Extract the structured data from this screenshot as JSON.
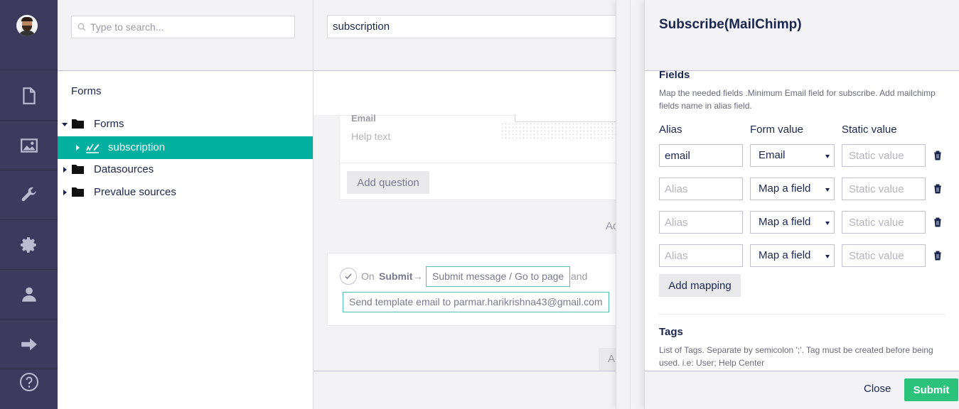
{
  "search": {
    "placeholder": "Type to search..."
  },
  "tree": {
    "title": "Forms",
    "nodes": [
      {
        "label": "Forms"
      },
      {
        "label": "subscription"
      },
      {
        "label": "Datasources"
      },
      {
        "label": "Prevalue sources"
      }
    ]
  },
  "editor": {
    "form_name": "subscription",
    "question_label": "Email",
    "help_text": "Help text",
    "add_question": "Add question",
    "ghost_add": "Ad",
    "ghost_add2": "A",
    "submit_row": {
      "on": "On",
      "submit": "Submit",
      "arrow": "→",
      "message": "Submit message / Go to page",
      "and": "and",
      "workflow": "Send template email to parmar.harikrishna43@gmail.com"
    }
  },
  "panel": {
    "title": "Subscribe(MailChimp)",
    "fields": {
      "heading": "Fields",
      "description": "Map the needed fields .Minimum Email field for subscribe. Add mailchimp fields name in alias field.",
      "col_alias": "Alias",
      "col_form_value": "Form value",
      "col_static_value": "Static value",
      "rows": [
        {
          "alias": "email",
          "alias_placeholder": "Alias",
          "form_value": "Email",
          "static_placeholder": "Static value"
        },
        {
          "alias": "",
          "alias_placeholder": "Alias",
          "form_value": "Map a field",
          "static_placeholder": "Static value"
        },
        {
          "alias": "",
          "alias_placeholder": "Alias",
          "form_value": "Map a field",
          "static_placeholder": "Static value"
        },
        {
          "alias": "",
          "alias_placeholder": "Alias",
          "form_value": "Map a field",
          "static_placeholder": "Static value"
        }
      ],
      "add_mapping": "Add mapping"
    },
    "tags": {
      "heading": "Tags",
      "description": "List of Tags. Separate by semicolon ';'. Tag must be created before being used. i.e: User; Help Center"
    },
    "close": "Close",
    "submit": "Submit"
  },
  "colors": {
    "rail": "#3e3a5e",
    "selected": "#03b0a0",
    "submit": "#2bc37c",
    "text": "#1b264f"
  },
  "icons": [
    "user-avatar",
    "content-icon",
    "media-icon",
    "settings-wrench-icon",
    "gear-icon",
    "member-icon",
    "forms-arrow-icon",
    "help-icon",
    "search-icon",
    "folder-icon",
    "form-icon",
    "check-icon",
    "trash-icon"
  ]
}
